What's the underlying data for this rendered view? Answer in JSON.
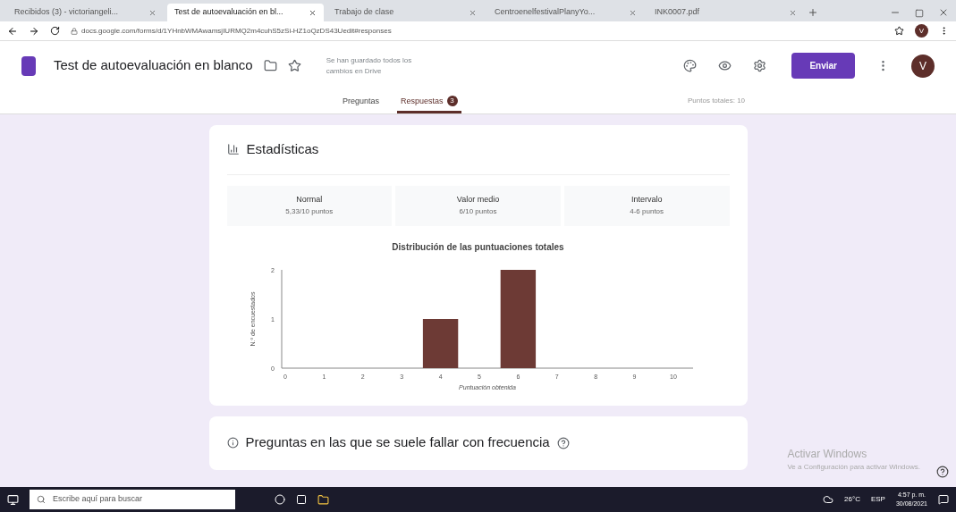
{
  "browser": {
    "tabs": [
      {
        "label": "Recibidos (3) - victoriangeli...",
        "selected": false
      },
      {
        "label": "Test de autoevaluación en bl...",
        "selected": true
      },
      {
        "label": "Trabajo de clase",
        "selected": false
      },
      {
        "label": "CentroenelfestivalPlanyYo...",
        "selected": false
      },
      {
        "label": "INK0007.pdf",
        "selected": false
      }
    ],
    "url": "docs.google.com/forms/d/1YHnbWMAwamsjIURMQ2m4cuhS5zSi-HZ1oQzDS43Uedit#responses",
    "avatar": "V"
  },
  "form": {
    "title": "Test de autoevaluación en blanco",
    "save_status": "Se han guardado todos los cambios en Drive",
    "send_button": "Enviar",
    "avatar": "V",
    "tabs": [
      {
        "label": "Preguntas",
        "selected": false
      },
      {
        "label": "Respuestas",
        "selected": true,
        "badge": "3"
      }
    ],
    "total_points": "Puntos totales: 10"
  },
  "stats": {
    "title": "Estadísticas",
    "summary": [
      {
        "label": "Normal",
        "value": "5,33/10 puntos"
      },
      {
        "label": "Valor medio",
        "value": "6/10 puntos"
      },
      {
        "label": "Intervalo",
        "value": "4-6 puntos"
      }
    ],
    "chart_data": {
      "type": "bar",
      "title": "Distribución de las puntuaciones totales",
      "xlabel": "Puntuación obtenida",
      "ylabel": "N.º de encuestados",
      "categories": [
        "0",
        "1",
        "2",
        "3",
        "4",
        "5",
        "6",
        "7",
        "8",
        "9",
        "10"
      ],
      "series": [
        {
          "color": "#6d3a35",
          "values": [
            0,
            0,
            0,
            0,
            1,
            0,
            2,
            0,
            0,
            0,
            0
          ]
        }
      ],
      "ylim": [
        0,
        2
      ],
      "yticks": [
        0,
        1,
        2
      ]
    }
  },
  "frequent": {
    "title": "Preguntas en las que se suele fallar con frecuencia"
  },
  "activation": {
    "title": "Activar Windows",
    "text": "Ve a Configuración para activar Windows."
  },
  "taskbar": {
    "search_placeholder": "Escribe aquí para buscar",
    "temperature": "26°C",
    "language": "ESP",
    "time": "4:57 p. m.",
    "date": "30/08/2021"
  }
}
